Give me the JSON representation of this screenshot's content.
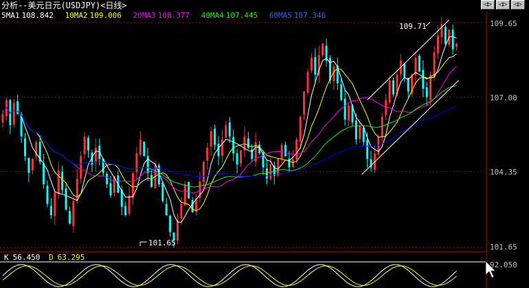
{
  "header": {
    "title": "分析--美元日元(USDJPY)<日线>",
    "nav_buttons": [
      "◁▷",
      "◁▷",
      "◁▷"
    ]
  },
  "ma_legend": [
    {
      "label": "5MA1",
      "value": "108.842",
      "color": "#ffffff"
    },
    {
      "label": "10MA2",
      "value": "109.006",
      "color": "#ffff00"
    },
    {
      "label": "20MA3",
      "value": "108.377",
      "color": "#ff00ff"
    },
    {
      "label": "40MA4",
      "value": "107.445",
      "color": "#00ff00"
    },
    {
      "label": "60MA5",
      "value": "107.346",
      "color": "#0000ff"
    }
  ],
  "indicator": {
    "k_label": "K",
    "k_value": "56.450",
    "d_label": "D",
    "d_value": "63.295",
    "axis_value": "92.050"
  },
  "annotations": {
    "high": "109.71",
    "low": "101.65"
  },
  "chart_data": {
    "type": "candlestick",
    "y_ticks": [
      "109.65",
      "107.00",
      "104.35",
      "101.65"
    ],
    "ylim": [
      101.65,
      109.65
    ],
    "grid": true,
    "colors": {
      "up": "#ff3030",
      "down": "#00ffff",
      "ma1": "#ffffff",
      "ma2": "#ffff00",
      "ma3": "#ff00ff",
      "ma4": "#00ff00",
      "ma5": "#0000ff"
    },
    "closes": [
      106.4,
      106.9,
      106.0,
      106.8,
      106.4,
      105.6,
      104.9,
      104.3,
      104.8,
      105.4,
      104.7,
      103.9,
      103.2,
      102.8,
      103.6,
      104.4,
      103.7,
      103.0,
      102.5,
      103.3,
      104.1,
      104.9,
      105.6,
      105.1,
      104.6,
      105.2,
      104.8,
      104.3,
      103.9,
      103.5,
      104.2,
      103.6,
      103.1,
      102.8,
      103.5,
      104.3,
      105.0,
      105.5,
      104.9,
      104.3,
      103.8,
      104.6,
      103.9,
      103.3,
      102.8,
      102.2,
      101.9,
      102.6,
      103.2,
      103.9,
      103.4,
      102.9,
      103.4,
      104.0,
      104.7,
      105.2,
      105.8,
      105.3,
      104.9,
      105.5,
      106.0,
      105.6,
      105.0,
      104.6,
      105.1,
      105.6,
      105.2,
      104.8,
      105.4,
      105.0,
      104.5,
      104.1,
      104.6,
      104.2,
      104.8,
      105.3,
      104.9,
      104.5,
      104.8,
      105.5,
      106.3,
      107.2,
      107.9,
      108.4,
      107.8,
      108.5,
      108.9,
      108.3,
      107.6,
      108.1,
      107.5,
      106.9,
      106.2,
      106.7,
      106.1,
      105.5,
      106.0,
      105.4,
      104.8,
      104.5,
      105.0,
      105.6,
      106.3,
      106.9,
      107.6,
      107.1,
      107.8,
      108.3,
      107.7,
      107.2,
      107.8,
      108.4,
      107.9,
      107.3,
      107.0,
      107.8,
      108.6,
      109.2,
      109.6,
      108.9,
      109.4,
      108.7,
      108.9
    ],
    "ma_last": {
      "ma1": 108.842,
      "ma2": 109.006,
      "ma3": 108.377,
      "ma4": 107.445,
      "ma5": 107.346
    }
  }
}
